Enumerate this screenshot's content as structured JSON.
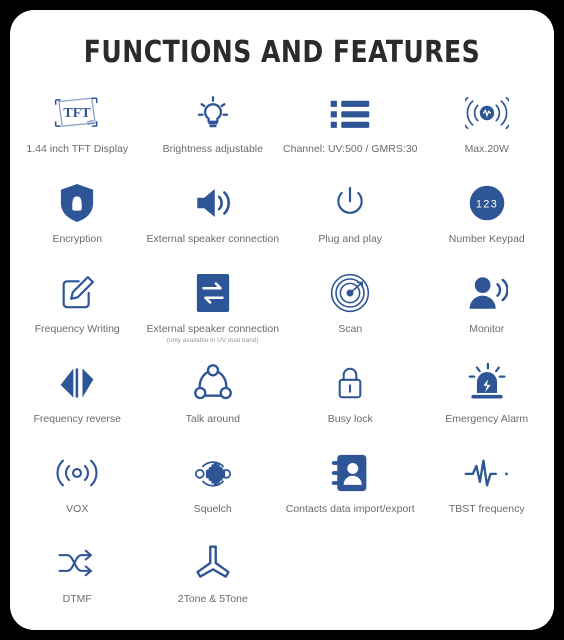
{
  "title": "FUNCTIONS AND FEATURES",
  "colors": {
    "icon_blue": "#2e5596",
    "icon_blue_light": "#3a5a96",
    "label_gray": "#6b6b6b",
    "sublabel_gray": "#9a9a9a",
    "title_black": "#2b2b2b",
    "card_bg": "#ffffff",
    "page_bg": "#000000"
  },
  "features": [
    {
      "icon": "tft-screen-icon",
      "label": "1.44 inch TFT Display",
      "sub": ""
    },
    {
      "icon": "light-bulb-icon",
      "label": "Brightness adjustable",
      "sub": ""
    },
    {
      "icon": "channel-list-icon",
      "label": "Channel: UV:500 / GMRS:30",
      "sub": ""
    },
    {
      "icon": "antenna-power-icon",
      "label": "Max.20W",
      "sub": ""
    },
    {
      "icon": "shield-lock-icon",
      "label": "Encryption",
      "sub": ""
    },
    {
      "icon": "speaker-icon",
      "label": "External speaker connection",
      "sub": ""
    },
    {
      "icon": "power-button-icon",
      "label": "Plug and play",
      "sub": ""
    },
    {
      "icon": "number-keypad-icon",
      "label": "Number Keypad",
      "sub": ""
    },
    {
      "icon": "pencil-write-icon",
      "label": "Frequency Writing",
      "sub": ""
    },
    {
      "icon": "transfer-arrows-icon",
      "label": "External speaker connection",
      "sub": "(only available in UV dual band)"
    },
    {
      "icon": "radar-scan-icon",
      "label": "Scan",
      "sub": ""
    },
    {
      "icon": "person-monitor-icon",
      "label": "Monitor",
      "sub": ""
    },
    {
      "icon": "frequency-reverse-icon",
      "label": "Frequency reverse",
      "sub": ""
    },
    {
      "icon": "talk-around-icon",
      "label": "Talk around",
      "sub": ""
    },
    {
      "icon": "padlock-icon",
      "label": "Busy lock",
      "sub": ""
    },
    {
      "icon": "siren-alarm-icon",
      "label": "Emergency Alarm",
      "sub": ""
    },
    {
      "icon": "vox-wave-icon",
      "label": "VOX",
      "sub": ""
    },
    {
      "icon": "squelch-icon",
      "label": "Squelch",
      "sub": ""
    },
    {
      "icon": "contacts-book-icon",
      "label": "Contacts data import/export",
      "sub": ""
    },
    {
      "icon": "tbst-waveform-icon",
      "label": "TBST frequency",
      "sub": ""
    },
    {
      "icon": "shuffle-arrows-icon",
      "label": "DTMF",
      "sub": ""
    },
    {
      "icon": "tone-branch-icon",
      "label": "2Tone & 5Tone",
      "sub": ""
    }
  ]
}
